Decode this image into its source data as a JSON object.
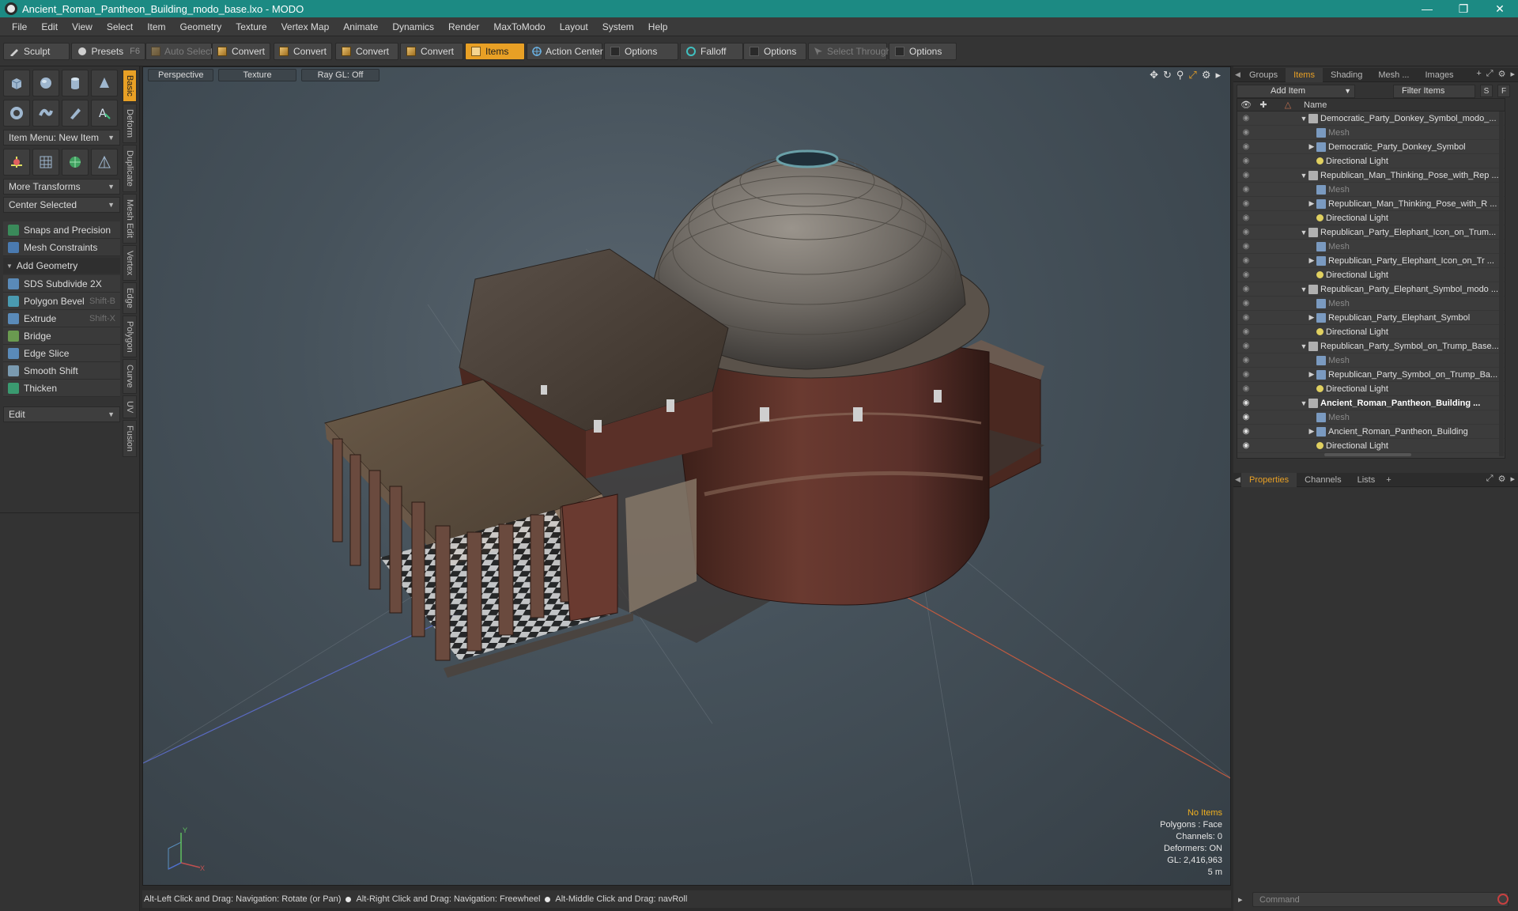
{
  "window": {
    "title": "Ancient_Roman_Pantheon_Building_modo_base.lxo - MODO",
    "controls": [
      "minimize-icon",
      "maximize-icon",
      "close-icon"
    ]
  },
  "menubar": [
    "File",
    "Edit",
    "View",
    "Select",
    "Item",
    "Geometry",
    "Texture",
    "Vertex Map",
    "Animate",
    "Dynamics",
    "Render",
    "MaxToModo",
    "Layout",
    "System",
    "Help"
  ],
  "toolbar": {
    "sculpt": "Sculpt",
    "presets": "Presets",
    "presets_shortcut": "F6",
    "auto_select": "Auto Select",
    "convert1": "Convert",
    "convert2": "Convert",
    "convert3": "Convert",
    "convert4": "Convert",
    "items": "Items",
    "action_center": "Action Center",
    "options1": "Options",
    "falloff": "Falloff",
    "options2": "Options",
    "select_through": "Select Through",
    "options3": "Options"
  },
  "leftpanel": {
    "item_menu": "Item Menu: New Item",
    "more_transforms": "More Transforms",
    "center_selected": "Center Selected",
    "snaps": "Snaps and Precision",
    "mesh_constraints": "Mesh Constraints",
    "add_geometry": "Add Geometry",
    "tools": [
      {
        "label": "SDS Subdivide 2X",
        "shortcut": ""
      },
      {
        "label": "Polygon Bevel",
        "shortcut": "Shift-B"
      },
      {
        "label": "Extrude",
        "shortcut": "Shift-X"
      },
      {
        "label": "Bridge",
        "shortcut": ""
      },
      {
        "label": "Edge Slice",
        "shortcut": ""
      },
      {
        "label": "Smooth Shift",
        "shortcut": ""
      },
      {
        "label": "Thicken",
        "shortcut": ""
      }
    ],
    "edit": "Edit",
    "vtabs": [
      "Basic",
      "Deform",
      "Duplicate",
      "Mesh Edit",
      "Vertex",
      "Edge",
      "Polygon",
      "Curve",
      "UV",
      "Fusion"
    ]
  },
  "viewport": {
    "tabs": [
      "Perspective",
      "Texture",
      "Ray GL: Off"
    ],
    "info": {
      "no_items": "No Items",
      "polygons": "Polygons : Face",
      "channels": "Channels: 0",
      "deformers": "Deformers: ON",
      "gl": "GL: 2,416,963",
      "scale": "5 m"
    },
    "axis_y": "Y",
    "axis_x": "X"
  },
  "statusbar": {
    "hint1": "Alt-Left Click and Drag: Navigation: Rotate (or Pan)",
    "hint2": "Alt-Right Click and Drag: Navigation: Freewheel",
    "hint3": "Alt-Middle Click and Drag: navRoll"
  },
  "rightpanel": {
    "tabs": [
      "Groups",
      "Items",
      "Shading",
      "Mesh ...",
      "Images"
    ],
    "add_item": "Add Item",
    "filter_items": "Filter Items",
    "s_btn": "S",
    "f_btn": "F",
    "name_col": "Name",
    "tree": [
      {
        "label": "Democratic_Party_Donkey_Symbol_modo_...",
        "kind": "scene",
        "level": 0,
        "arrow": "▼",
        "dim": false,
        "bold": false,
        "eye": false
      },
      {
        "label": "Mesh",
        "kind": "mesh",
        "level": 1,
        "arrow": "",
        "dim": true,
        "bold": false,
        "eye": false
      },
      {
        "label": "Democratic_Party_Donkey_Symbol",
        "kind": "mesh",
        "level": 1,
        "arrow": "▶",
        "dim": false,
        "bold": false,
        "eye": false
      },
      {
        "label": "Directional Light",
        "kind": "light",
        "level": 1,
        "arrow": "",
        "dim": false,
        "bold": false,
        "eye": false
      },
      {
        "label": "Republican_Man_Thinking_Pose_with_Rep ...",
        "kind": "scene",
        "level": 0,
        "arrow": "▼",
        "dim": false,
        "bold": false,
        "eye": false
      },
      {
        "label": "Mesh",
        "kind": "mesh",
        "level": 1,
        "arrow": "",
        "dim": true,
        "bold": false,
        "eye": false
      },
      {
        "label": "Republican_Man_Thinking_Pose_with_R ...",
        "kind": "mesh",
        "level": 1,
        "arrow": "▶",
        "dim": false,
        "bold": false,
        "eye": false
      },
      {
        "label": "Directional Light",
        "kind": "light",
        "level": 1,
        "arrow": "",
        "dim": false,
        "bold": false,
        "eye": false
      },
      {
        "label": "Republican_Party_Elephant_Icon_on_Trum...",
        "kind": "scene",
        "level": 0,
        "arrow": "▼",
        "dim": false,
        "bold": false,
        "eye": false
      },
      {
        "label": "Mesh",
        "kind": "mesh",
        "level": 1,
        "arrow": "",
        "dim": true,
        "bold": false,
        "eye": false
      },
      {
        "label": "Republican_Party_Elephant_Icon_on_Tr ...",
        "kind": "mesh",
        "level": 1,
        "arrow": "▶",
        "dim": false,
        "bold": false,
        "eye": false
      },
      {
        "label": "Directional Light",
        "kind": "light",
        "level": 1,
        "arrow": "",
        "dim": false,
        "bold": false,
        "eye": false
      },
      {
        "label": "Republican_Party_Elephant_Symbol_modo ...",
        "kind": "scene",
        "level": 0,
        "arrow": "▼",
        "dim": false,
        "bold": false,
        "eye": false
      },
      {
        "label": "Mesh",
        "kind": "mesh",
        "level": 1,
        "arrow": "",
        "dim": true,
        "bold": false,
        "eye": false
      },
      {
        "label": "Republican_Party_Elephant_Symbol",
        "kind": "mesh",
        "level": 1,
        "arrow": "▶",
        "dim": false,
        "bold": false,
        "eye": false
      },
      {
        "label": "Directional Light",
        "kind": "light",
        "level": 1,
        "arrow": "",
        "dim": false,
        "bold": false,
        "eye": false
      },
      {
        "label": "Republican_Party_Symbol_on_Trump_Base...",
        "kind": "scene",
        "level": 0,
        "arrow": "▼",
        "dim": false,
        "bold": false,
        "eye": false
      },
      {
        "label": "Mesh",
        "kind": "mesh",
        "level": 1,
        "arrow": "",
        "dim": true,
        "bold": false,
        "eye": false
      },
      {
        "label": "Republican_Party_Symbol_on_Trump_Ba...",
        "kind": "mesh",
        "level": 1,
        "arrow": "▶",
        "dim": false,
        "bold": false,
        "eye": false
      },
      {
        "label": "Directional Light",
        "kind": "light",
        "level": 1,
        "arrow": "",
        "dim": false,
        "bold": false,
        "eye": false
      },
      {
        "label": "Ancient_Roman_Pantheon_Building ...",
        "kind": "scene",
        "level": 0,
        "arrow": "▼",
        "dim": false,
        "bold": true,
        "eye": true
      },
      {
        "label": "Mesh",
        "kind": "mesh",
        "level": 1,
        "arrow": "",
        "dim": true,
        "bold": false,
        "eye": true
      },
      {
        "label": "Ancient_Roman_Pantheon_Building",
        "kind": "mesh",
        "level": 1,
        "arrow": "▶",
        "dim": false,
        "bold": false,
        "eye": true
      },
      {
        "label": "Directional Light",
        "kind": "light",
        "level": 1,
        "arrow": "",
        "dim": false,
        "bold": false,
        "eye": true
      }
    ],
    "props_tabs": [
      "Properties",
      "Channels",
      "Lists"
    ],
    "command_placeholder": "Command"
  },
  "colors": {
    "accent": "#e8a025",
    "titlebar": "#1c8a83"
  }
}
